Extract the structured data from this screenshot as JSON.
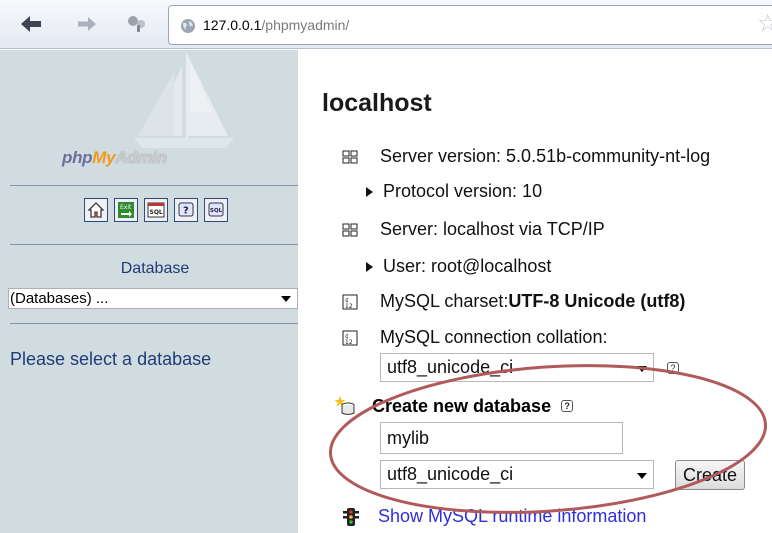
{
  "browser": {
    "url_host": "127.0.0.1",
    "url_path": "/phpmyadmin/",
    "icons": [
      "back-arrow-icon",
      "forward-arrow-icon",
      "extension-icon",
      "globe-icon",
      "bookmark-star-icon"
    ]
  },
  "sidebar": {
    "logo": "phpMyAdmin",
    "toolbar_icons": [
      "home-icon",
      "exit-icon",
      "sql-query-icon",
      "help-icon",
      "sql-docs-icon"
    ],
    "database_label": "Database",
    "database_select_value": "(Databases) ...",
    "prompt": "Please select a database"
  },
  "main": {
    "title": "localhost",
    "server_version": "Server version: 5.0.51b-community-nt-log",
    "protocol_version": "Protocol version: 10",
    "server_host": "Server: localhost via TCP/IP",
    "user": "User: root@localhost",
    "charset_label": "MySQL charset: ",
    "charset_value": "UTF-8 Unicode (utf8)",
    "collation_label": "MySQL connection collation:",
    "collation_value": "utf8_unicode_ci",
    "create_db_heading": "Create new database",
    "new_db_name": "mylib",
    "new_db_collation": "utf8_unicode_ci",
    "create_button": "Create",
    "runtime_link": "Show MySQL runtime information",
    "help_glyph": "?"
  },
  "colors": {
    "sidebar_bg": "#d0dce0",
    "link": "#2e2ee0",
    "annotation_ellipse": "#b05a5a"
  }
}
